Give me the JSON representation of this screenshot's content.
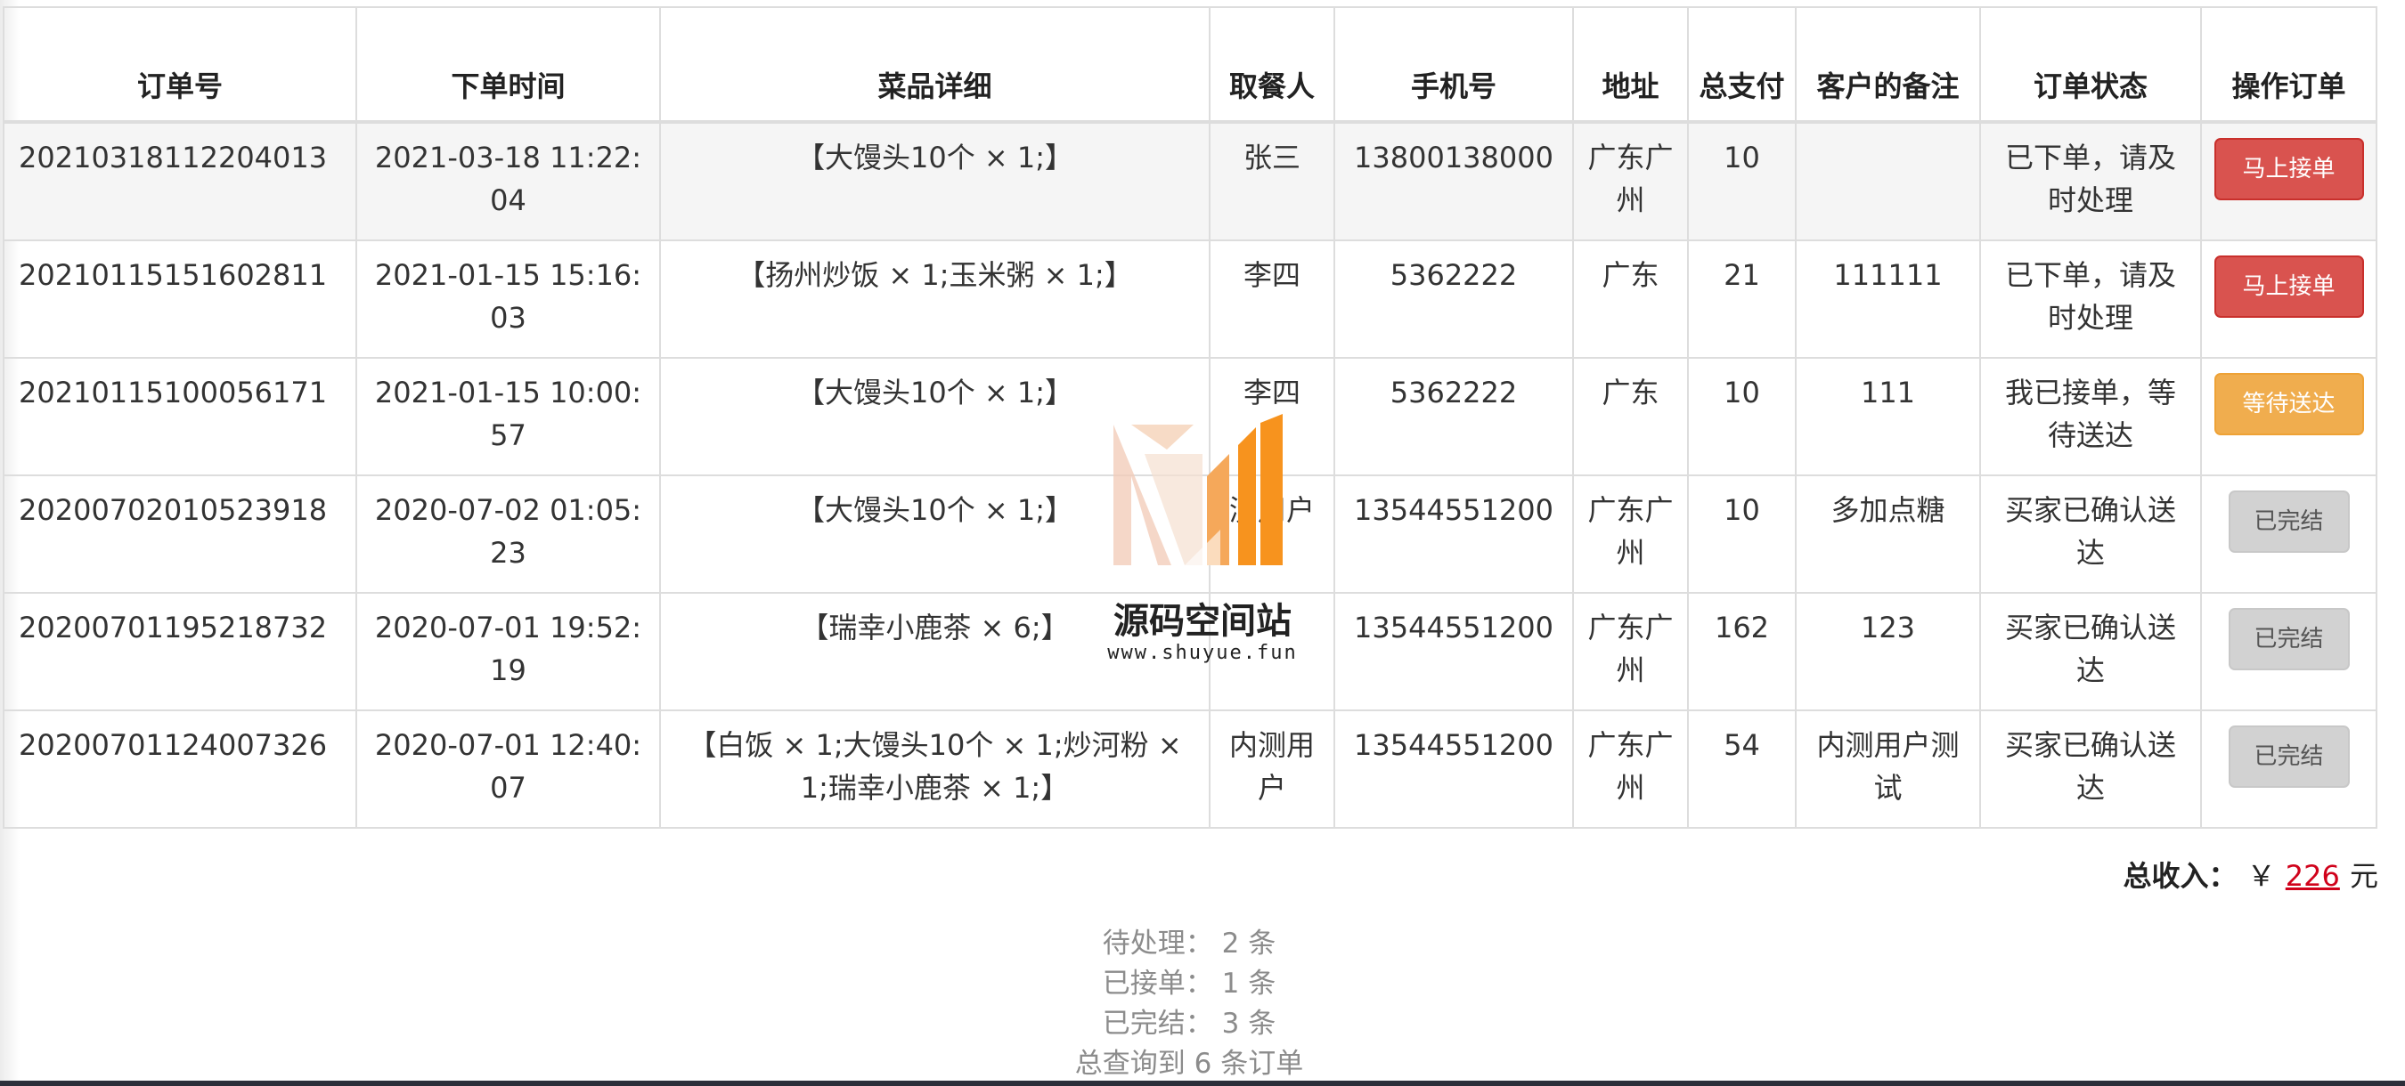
{
  "table": {
    "headers": [
      "订单号",
      "下单时间",
      "菜品详细",
      "取餐人",
      "手机号",
      "地址",
      "总支付",
      "客户的备注",
      "订单状态",
      "操作订单"
    ],
    "rows": [
      {
        "order_id": "20210318112204013",
        "time": "2021-03-18 11:22:04",
        "items": "【大馒头10个 × 1;】",
        "receiver": "张三",
        "phone": "13800138000",
        "address": "广东广州",
        "total": "10",
        "remark": "",
        "status": "已下单，请及时处理",
        "action": "马上接单",
        "action_type": "danger"
      },
      {
        "order_id": "20210115151602811",
        "time": "2021-01-15 15:16:03",
        "items": "【扬州炒饭 × 1;玉米粥 × 1;】",
        "receiver": "李四",
        "phone": "5362222",
        "address": "广东",
        "total": "21",
        "remark": "111111",
        "status": "已下单，请及时处理",
        "action": "马上接单",
        "action_type": "danger"
      },
      {
        "order_id": "20210115100056171",
        "time": "2021-01-15 10:00:57",
        "items": "【大馒头10个 × 1;】",
        "receiver": "李四",
        "phone": "5362222",
        "address": "广东",
        "total": "10",
        "remark": "111",
        "status": "我已接单，等待送达",
        "action": "等待送达",
        "action_type": "warning"
      },
      {
        "order_id": "20200702010523918",
        "time": "2020-07-02 01:05:23",
        "items": "【大馒头10个 × 1;】",
        "receiver": "测用户",
        "phone": "13544551200",
        "address": "广东广州",
        "total": "10",
        "remark": "多加点糖",
        "status": "买家已确认送达",
        "action": "已完结",
        "action_type": "default"
      },
      {
        "order_id": "20200701195218732",
        "time": "2020-07-01 19:52:19",
        "items": "【瑞幸小鹿茶 × 6;】",
        "receiver": "",
        "phone": "13544551200",
        "address": "广东广州",
        "total": "162",
        "remark": "123",
        "status": "买家已确认送达",
        "action": "已完结",
        "action_type": "default"
      },
      {
        "order_id": "20200701124007326",
        "time": "2020-07-01 12:40:07",
        "items": "【白饭 × 1;大馒头10个 × 1;炒河粉 × 1;瑞幸小鹿茶 × 1;】",
        "receiver": "内测用户",
        "phone": "13544551200",
        "address": "广东广州",
        "total": "54",
        "remark": "内测用户测试",
        "status": "买家已确认送达",
        "action": "已完结",
        "action_type": "default"
      }
    ]
  },
  "income": {
    "label": "总收入：",
    "currency": "￥",
    "amount": "226",
    "unit": "元"
  },
  "summary": {
    "pending": "待处理： 2 条",
    "accepted": "已接单： 1 条",
    "completed": "已完结： 3 条",
    "total": "总查询到 6 条订单"
  },
  "watermark": {
    "title": "源码空间站",
    "url": "www.shuyue.fun"
  },
  "colors": {
    "danger": "#d9534f",
    "warning": "#f0ad4e",
    "default": "#d2d2d2",
    "amount": "#d0021b",
    "watermark_orange": "#f7931e"
  }
}
